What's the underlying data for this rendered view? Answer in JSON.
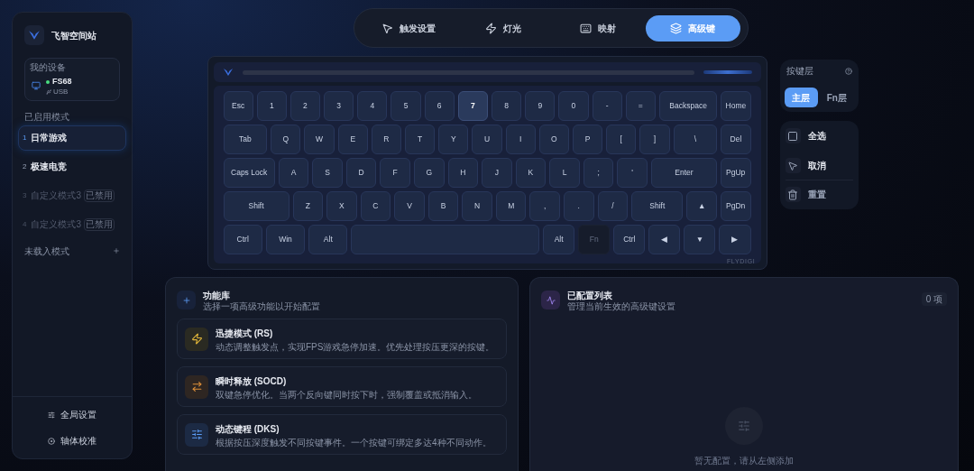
{
  "sidebar": {
    "app_name": "飞智空间站",
    "device": {
      "section": "我的设备",
      "name": "FS68",
      "online": true,
      "connection": "USB"
    },
    "enabled_section": "已启用模式",
    "modes": [
      {
        "number": "1",
        "name": "日常游戏",
        "selected": true,
        "disabled": false
      },
      {
        "number": "2",
        "name": "极速电竞",
        "selected": false,
        "disabled": false
      },
      {
        "number": "3",
        "name": "自定义模式3",
        "selected": false,
        "disabled": true,
        "badge": "已禁用"
      },
      {
        "number": "4",
        "name": "自定义模式3",
        "selected": false,
        "disabled": true,
        "badge": "已禁用"
      }
    ],
    "unloaded_section": "未载入模式",
    "footer": [
      {
        "kind": "settings",
        "label": "全局设置"
      },
      {
        "kind": "calibrate",
        "label": "轴体校准"
      }
    ]
  },
  "tabs": [
    {
      "kind": "pointer",
      "label": "触发设置",
      "selected": false
    },
    {
      "kind": "bolt",
      "label": "灯光",
      "selected": false
    },
    {
      "kind": "keyboard",
      "label": "映射",
      "selected": false
    },
    {
      "kind": "layers",
      "label": "高级键",
      "selected": true
    }
  ],
  "keyboard": {
    "brand": "FLYDIGI",
    "rows": [
      {
        "keys": [
          {
            "kind": "key",
            "label": "Esc"
          },
          {
            "kind": "key",
            "label": "1"
          },
          {
            "kind": "key",
            "label": "2"
          },
          {
            "kind": "key",
            "label": "3"
          },
          {
            "kind": "key",
            "label": "4"
          },
          {
            "kind": "key",
            "label": "5"
          },
          {
            "kind": "key",
            "label": "6"
          },
          {
            "kind": "key",
            "label": "7",
            "selected": true
          },
          {
            "kind": "key",
            "label": "8"
          },
          {
            "kind": "key",
            "label": "9"
          },
          {
            "kind": "key",
            "label": "0"
          },
          {
            "kind": "key",
            "label": "-"
          },
          {
            "kind": "key",
            "label": "="
          },
          {
            "kind": "key",
            "label": "Backspace"
          },
          {
            "kind": "key",
            "label": "Home"
          }
        ]
      },
      {
        "keys": [
          {
            "kind": "key",
            "label": "Tab"
          },
          {
            "kind": "key",
            "label": "Q"
          },
          {
            "kind": "key",
            "label": "W"
          },
          {
            "kind": "key",
            "label": "E"
          },
          {
            "kind": "key",
            "label": "R"
          },
          {
            "kind": "key",
            "label": "T"
          },
          {
            "kind": "key",
            "label": "Y"
          },
          {
            "kind": "key",
            "label": "U"
          },
          {
            "kind": "key",
            "label": "I"
          },
          {
            "kind": "key",
            "label": "O"
          },
          {
            "kind": "key",
            "label": "P"
          },
          {
            "kind": "key",
            "label": "["
          },
          {
            "kind": "key",
            "label": "]"
          },
          {
            "kind": "key",
            "label": "\\"
          },
          {
            "kind": "key",
            "label": "Del"
          }
        ]
      },
      {
        "keys": [
          {
            "kind": "key",
            "label": "Caps Lock"
          },
          {
            "kind": "key",
            "label": "A"
          },
          {
            "kind": "key",
            "label": "S"
          },
          {
            "kind": "key",
            "label": "D"
          },
          {
            "kind": "key",
            "label": "F"
          },
          {
            "kind": "key",
            "label": "G"
          },
          {
            "kind": "key",
            "label": "H"
          },
          {
            "kind": "key",
            "label": "J"
          },
          {
            "kind": "key",
            "label": "K"
          },
          {
            "kind": "key",
            "label": "L"
          },
          {
            "kind": "key",
            "label": ";"
          },
          {
            "kind": "key",
            "label": "'"
          },
          {
            "kind": "key",
            "label": "Enter"
          },
          {
            "kind": "key",
            "label": "PgUp"
          }
        ]
      },
      {
        "keys": [
          {
            "kind": "key",
            "label": "Shift"
          },
          {
            "kind": "key",
            "label": "Z"
          },
          {
            "kind": "key",
            "label": "X"
          },
          {
            "kind": "key",
            "label": "C"
          },
          {
            "kind": "key",
            "label": "V"
          },
          {
            "kind": "key",
            "label": "B"
          },
          {
            "kind": "key",
            "label": "N"
          },
          {
            "kind": "key",
            "label": "M"
          },
          {
            "kind": "key",
            "label": ","
          },
          {
            "kind": "key",
            "label": "."
          },
          {
            "kind": "key",
            "label": "/"
          },
          {
            "kind": "key",
            "label": "Shift"
          },
          {
            "kind": "key",
            "label": "▲"
          },
          {
            "kind": "key",
            "label": "PgDn"
          }
        ]
      },
      {
        "keys": [
          {
            "kind": "key",
            "label": "Ctrl"
          },
          {
            "kind": "key",
            "label": "Win"
          },
          {
            "kind": "key",
            "label": "Alt"
          },
          {
            "kind": "space"
          },
          {
            "kind": "key",
            "label": "Alt"
          },
          {
            "kind": "key",
            "label": "Fn",
            "disabled": true
          },
          {
            "kind": "key",
            "label": "Ctrl"
          },
          {
            "kind": "key",
            "label": "◀"
          },
          {
            "kind": "key",
            "label": "▼"
          },
          {
            "kind": "key",
            "label": "▶"
          }
        ]
      }
    ]
  },
  "layer_panel": {
    "title": "按键层",
    "layers": [
      {
        "label": "主层",
        "selected": true
      },
      {
        "label": "Fn层",
        "selected": false
      }
    ]
  },
  "actions": [
    {
      "kind": "select-all",
      "label": "全选"
    },
    {
      "kind": "cancel",
      "label": "取消"
    },
    {
      "kind": "reset",
      "label": "重置"
    }
  ],
  "library": {
    "title": "功能库",
    "subtitle": "选择一项高级功能以开始配置",
    "items": [
      {
        "kind": "rs",
        "title": "迅捷模式 (RS)",
        "description": "动态调整触发点，实现FPS游戏急停加速。优先处理按压更深的按键。"
      },
      {
        "kind": "socd",
        "title": "瞬时释放 (SOCD)",
        "description": "双键急停优化。当两个反向键同时按下时，强制覆盖或抵消输入。"
      },
      {
        "kind": "dks",
        "title": "动态键程 (DKS)",
        "description": "根据按压深度触发不同按键事件。一个按键可绑定多达4种不同动作。"
      }
    ]
  },
  "configured": {
    "title": "已配置列表",
    "subtitle": "管理当前生效的高级键设置",
    "count": "0 项",
    "empty_text": "暂无配置，请从左侧添加"
  }
}
